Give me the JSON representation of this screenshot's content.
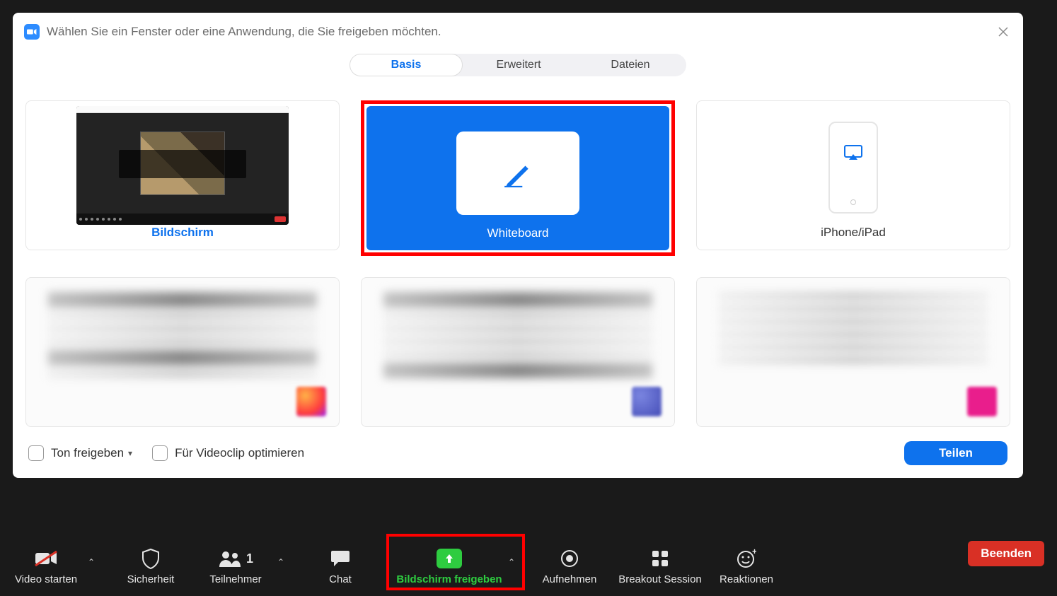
{
  "dialog": {
    "title": "Wählen Sie ein Fenster oder eine Anwendung, die Sie freigeben möchten.",
    "tabs": [
      "Basis",
      "Erweitert",
      "Dateien"
    ],
    "options": {
      "screen": "Bildschirm",
      "whiteboard": "Whiteboard",
      "iphone": "iPhone/iPad"
    },
    "checkboxes": {
      "share_audio": "Ton freigeben",
      "optimize_video": "Für Videoclip optimieren"
    },
    "share_button": "Teilen"
  },
  "toolbar": {
    "video": "Video starten",
    "security": "Sicherheit",
    "participants": "Teilnehmer",
    "participants_count": "1",
    "chat": "Chat",
    "share_screen": "Bildschirm freigeben",
    "record": "Aufnehmen",
    "breakout": "Breakout Session",
    "reactions": "Reaktionen",
    "end": "Beenden"
  }
}
